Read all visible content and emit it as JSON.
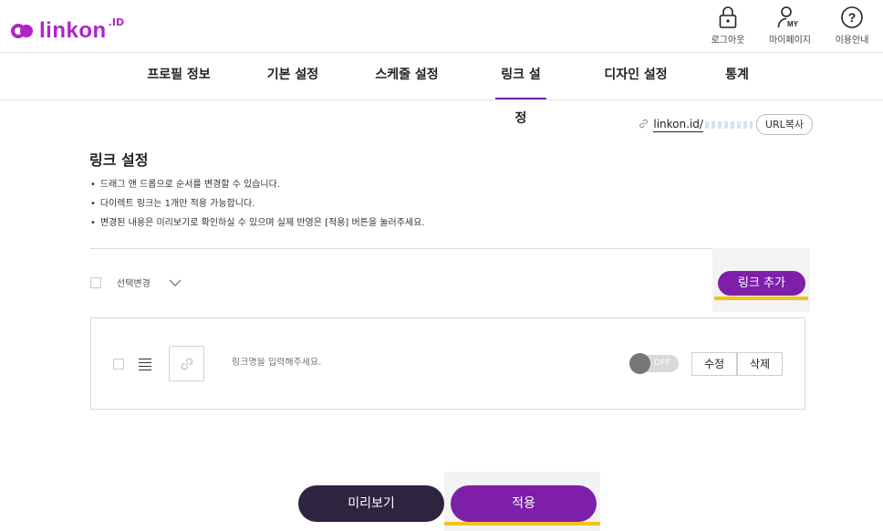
{
  "brand": {
    "name": "linkon",
    "suffix": ".ID",
    "color": "#b023c9"
  },
  "top_actions": [
    {
      "label": "로그아웃",
      "icon": "lock-icon"
    },
    {
      "label": "마이페이지",
      "icon": "user-my-icon"
    },
    {
      "label": "이용안내",
      "icon": "help-icon"
    }
  ],
  "nav": {
    "items": [
      {
        "label": "프로필 정보"
      },
      {
        "label": "기본 설정"
      },
      {
        "label": "스케줄 설정"
      },
      {
        "label": "링크 설정",
        "active": true
      },
      {
        "label": "디자인 설정"
      },
      {
        "label": "통계"
      }
    ]
  },
  "url": {
    "text": "linkon.id/",
    "copy_label": "URL복사"
  },
  "section": {
    "title": "링크 설정",
    "notes": [
      "드래그 앤 드롭으로 순서를 변경할 수 있습니다.",
      "다이렉트 링크는 1개만 적용 가능합니다.",
      "변경된 내용은 미리보기로 확인하실 수 있으며 실제 반영은 [적용] 버튼을 눌러주세요."
    ]
  },
  "toolbar": {
    "select_label": "선택변경",
    "add_label": "링크 추가"
  },
  "link_item": {
    "name_placeholder": "링크명을 입력해주세요.",
    "toggle_state": "OFF",
    "edit_label": "수정",
    "delete_label": "삭제"
  },
  "footer": {
    "preview_label": "미리보기",
    "apply_label": "적용"
  },
  "colors": {
    "accent": "#7d1fa8",
    "dark": "#2e2440",
    "highlight": "#f0c419"
  }
}
